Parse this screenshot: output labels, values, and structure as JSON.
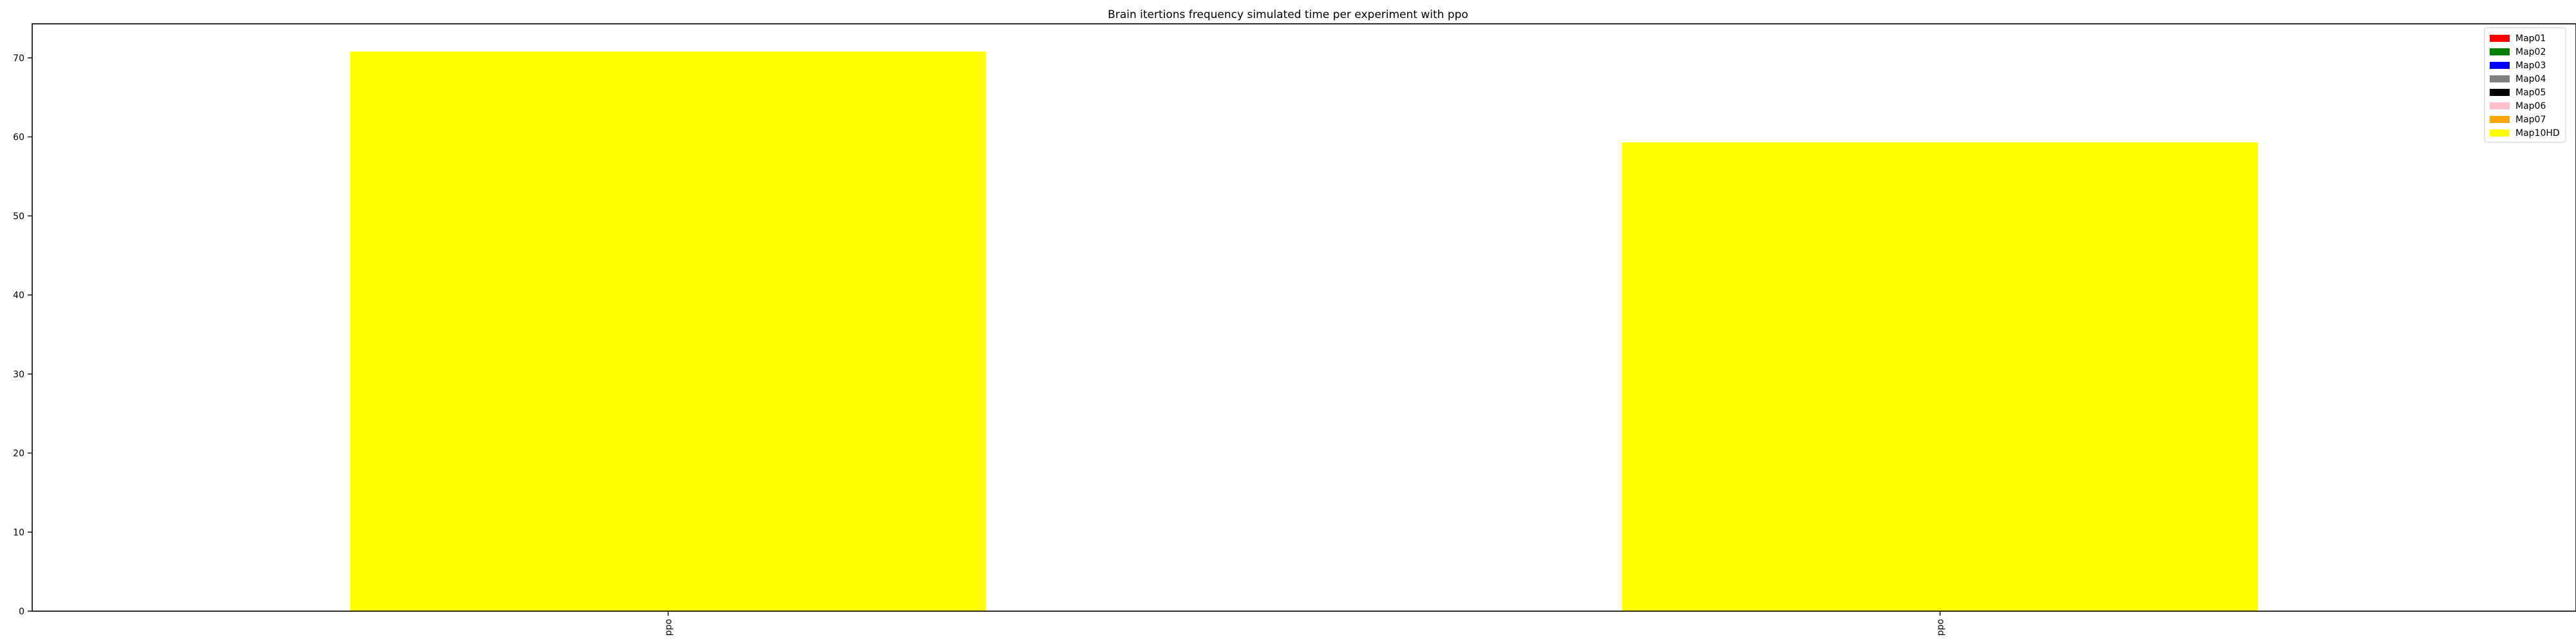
{
  "chart_data": {
    "type": "bar",
    "title": "Brain itertions frequency simulated time per experiment with ppo",
    "xlabel": "",
    "ylabel": "",
    "categories": [
      "ppo",
      "ppo"
    ],
    "series": [
      {
        "name": "Map10HD",
        "values": [
          70.8,
          59.3
        ],
        "color": "#ffff00"
      }
    ],
    "ylim": [
      0,
      74.3
    ],
    "yticks": [
      0,
      10,
      20,
      30,
      40,
      50,
      60,
      70
    ],
    "grid": false,
    "legend": {
      "placement": "top-right",
      "entries": [
        {
          "label": "Map01",
          "color": "#ff0000"
        },
        {
          "label": "Map02",
          "color": "#008000"
        },
        {
          "label": "Map03",
          "color": "#0000ff"
        },
        {
          "label": "Map04",
          "color": "#808080"
        },
        {
          "label": "Map05",
          "color": "#000000"
        },
        {
          "label": "Map06",
          "color": "#ffc0cb"
        },
        {
          "label": "Map07",
          "color": "#ffa500"
        },
        {
          "label": "Map10HD",
          "color": "#ffff00"
        }
      ]
    }
  }
}
